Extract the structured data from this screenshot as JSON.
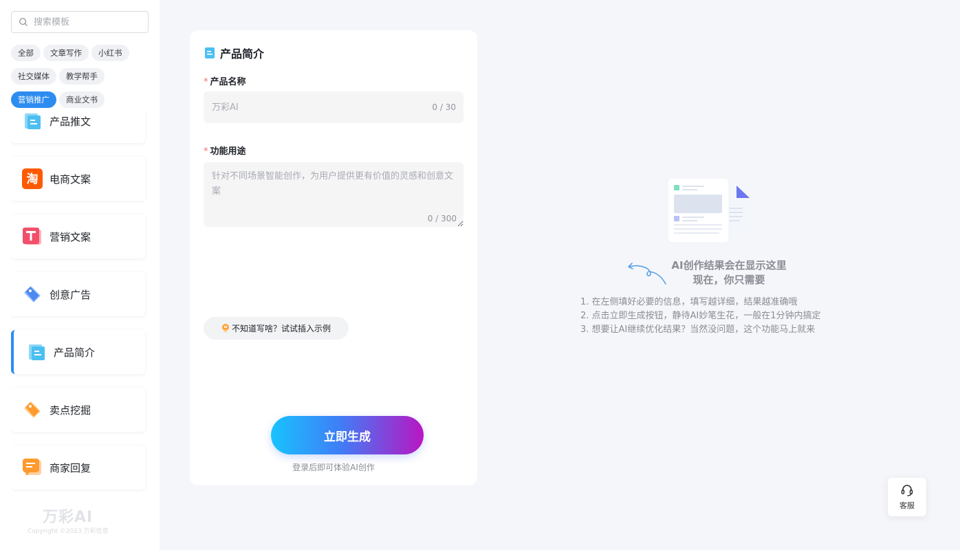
{
  "search": {
    "placeholder": "搜索模板"
  },
  "tags": [
    {
      "label": "全部",
      "active": false
    },
    {
      "label": "文章写作",
      "active": false
    },
    {
      "label": "小红书",
      "active": false
    },
    {
      "label": "社交媒体",
      "active": false
    },
    {
      "label": "教学帮手",
      "active": false
    },
    {
      "label": "营销推广",
      "active": true
    },
    {
      "label": "商业文书",
      "active": false
    }
  ],
  "categories": [
    {
      "label": "产品推文",
      "icon": "document-icon",
      "active": false
    },
    {
      "label": "电商文案",
      "icon": "taobao-icon",
      "active": false
    },
    {
      "label": "营销文案",
      "icon": "text-t-icon",
      "active": false
    },
    {
      "label": "创意广告",
      "icon": "tag-icon",
      "active": false
    },
    {
      "label": "产品简介",
      "icon": "document-icon",
      "active": true
    },
    {
      "label": "卖点挖掘",
      "icon": "tag-icon",
      "active": false
    },
    {
      "label": "商家回复",
      "icon": "chat-icon",
      "active": false
    }
  ],
  "brand": {
    "name": "万彩AI",
    "copyright": "Copyright ©2023 万彩信息"
  },
  "form": {
    "title": "产品简介",
    "fields": {
      "product_name": {
        "label": "产品名称",
        "required_mark": "*",
        "placeholder": "万彩AI",
        "value": "",
        "counter": "0 / 30"
      },
      "function_use": {
        "label": "功能用途",
        "required_mark": "*",
        "placeholder": "针对不同场景智能创作，为用户提供更有价值的灵感和创意文案",
        "value": "",
        "counter": "0 / 300"
      }
    },
    "example_button": "不知道写啥？试试插入示例",
    "generate_button": "立即生成",
    "generate_hint": "登录后即可体验AI创作"
  },
  "result": {
    "title_line1": "AI创作结果会在显示这里",
    "title_line2": "现在，你只需要",
    "steps": [
      "1. 在左侧填好必要的信息，填写越详细，结果越准确哦",
      "2. 点击立即生成按钮，静待AI妙笔生花，一般在1分钟内搞定",
      "3. 想要让AI继续优化结果？当然没问题，这个功能马上就来"
    ]
  },
  "service": {
    "label": "客服"
  },
  "colors": {
    "accent": "#2d8cf0",
    "required": "#f56c6c",
    "gradient_start": "#18c3ff",
    "gradient_end": "#b916c3"
  }
}
